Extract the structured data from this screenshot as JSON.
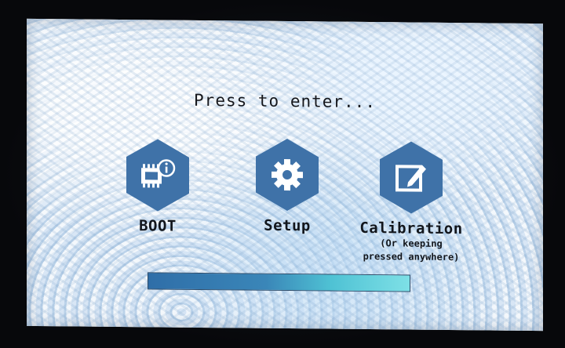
{
  "prompt": "Press to enter...",
  "options": [
    {
      "label": "BOOT",
      "icon": "chip-info-icon"
    },
    {
      "label": "Setup",
      "icon": "gear-icon"
    },
    {
      "label": "Calibration",
      "icon": "edit-pen-icon",
      "sub_lines": [
        "(Or keeping",
        "pressed anywhere)"
      ]
    }
  ],
  "progress": {
    "percent": 100
  },
  "colors": {
    "hex_icon": "#3f72a8",
    "text": "#12161c",
    "progress_fill": "#3a86b8"
  }
}
